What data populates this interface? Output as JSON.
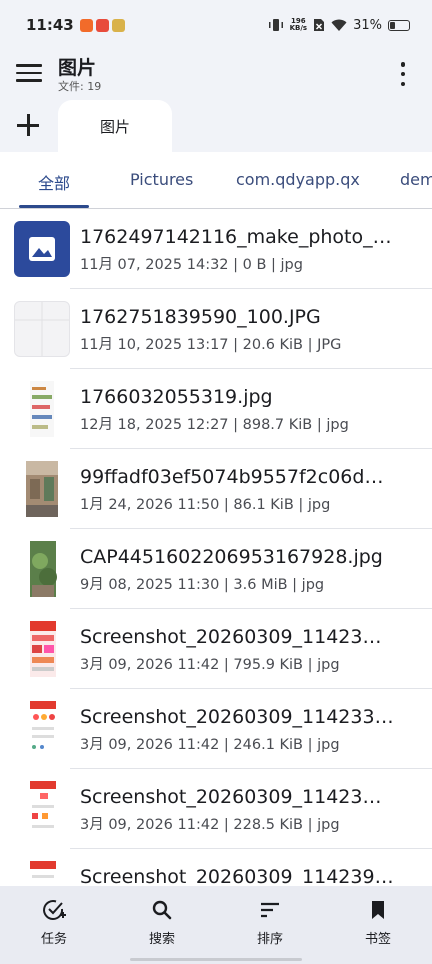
{
  "status_bar": {
    "time": "11:43",
    "net_speed_value": "196",
    "net_speed_unit": "KB/s",
    "battery": "31%",
    "battery_level": 0.31
  },
  "app_bar": {
    "title": "图片",
    "subtitle": "文件: 19"
  },
  "tabs": {
    "open_tab": "图片"
  },
  "filter_tabs": [
    "全部",
    "Pictures",
    "com.qdyapp.qx",
    "dem"
  ],
  "files": [
    {
      "name": "1762497142116_make_photo_…",
      "meta": "11月 07, 2025 14:32 | 0 B | jpg",
      "thumb": "image-placeholder-icon"
    },
    {
      "name": "1762751839590_100.JPG",
      "meta": "11月 10, 2025 13:17 | 20.6 KiB | JPG",
      "thumb": "blank-grid"
    },
    {
      "name": "1766032055319.jpg",
      "meta": "12月 18, 2025 12:27 | 898.7 KiB | jpg",
      "thumb": "document-photo"
    },
    {
      "name": "99ffadf03ef5074b9557f2c06d…",
      "meta": "1月 24, 2026 11:50 | 86.1 KiB | jpg",
      "thumb": "street-photo"
    },
    {
      "name": "CAP4451602206953167928.jpg",
      "meta": "9月 08, 2025 11:30 | 3.6 MiB | jpg",
      "thumb": "plant-photo"
    },
    {
      "name": "Screenshot_20260309_11423…",
      "meta": "3月 09, 2026 11:42 | 795.9 KiB | jpg",
      "thumb": "screenshot"
    },
    {
      "name": "Screenshot_20260309_114233…",
      "meta": "3月 09, 2026 11:42 | 246.1 KiB | jpg",
      "thumb": "screenshot"
    },
    {
      "name": "Screenshot_20260309_11423…",
      "meta": "3月 09, 2026 11:42 | 228.5 KiB | jpg",
      "thumb": "screenshot"
    },
    {
      "name": "Screenshot_20260309_114239…",
      "meta": "",
      "thumb": "screenshot"
    }
  ],
  "bottom_nav": [
    {
      "label": "任务",
      "icon": "task-check-icon"
    },
    {
      "label": "搜索",
      "icon": "search-icon"
    },
    {
      "label": "排序",
      "icon": "sort-icon"
    },
    {
      "label": "书签",
      "icon": "bookmark-icon"
    }
  ],
  "colors": {
    "accent": "#2c4a8c",
    "background": "#f1f3f8",
    "surface": "#ffffff"
  }
}
